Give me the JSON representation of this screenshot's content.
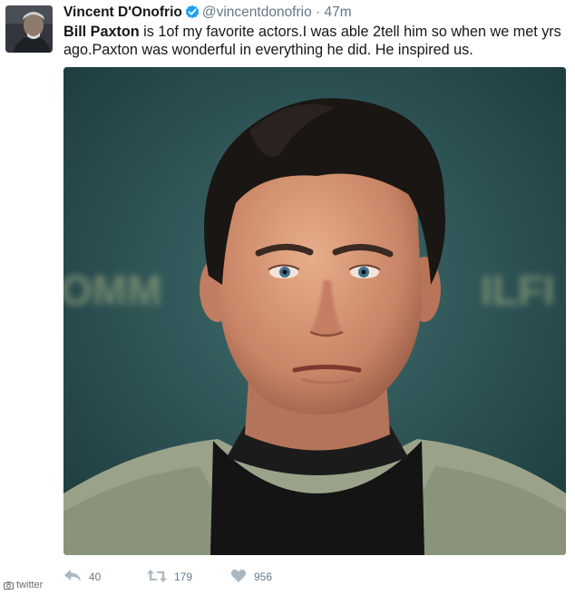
{
  "tweet": {
    "author_name": "Vincent D'Onofrio",
    "handle": "@vincentdonofrio",
    "separator": "·",
    "time": "47m",
    "mention": "Bill Paxton",
    "text_rest": " is 1of my favorite actors.I was able 2tell him so when we met yrs ago.Paxton was wonderful in everything he did. He inspired us.",
    "media": {
      "background_lettering_left": "OMM",
      "background_lettering_right": "ILFI",
      "description_icon": "photo-portrait"
    }
  },
  "actions": {
    "reply_count": "40",
    "retweet_count": "179",
    "like_count": "956"
  },
  "watermark": {
    "label": "twitter"
  },
  "colors": {
    "text": "#14171a",
    "secondary": "#657786",
    "verified": "#1da1f2",
    "action_icon": "#aab8c2"
  },
  "icons": [
    "verified-badge-icon",
    "reply-icon",
    "retweet-icon",
    "heart-icon",
    "camera-icon"
  ]
}
